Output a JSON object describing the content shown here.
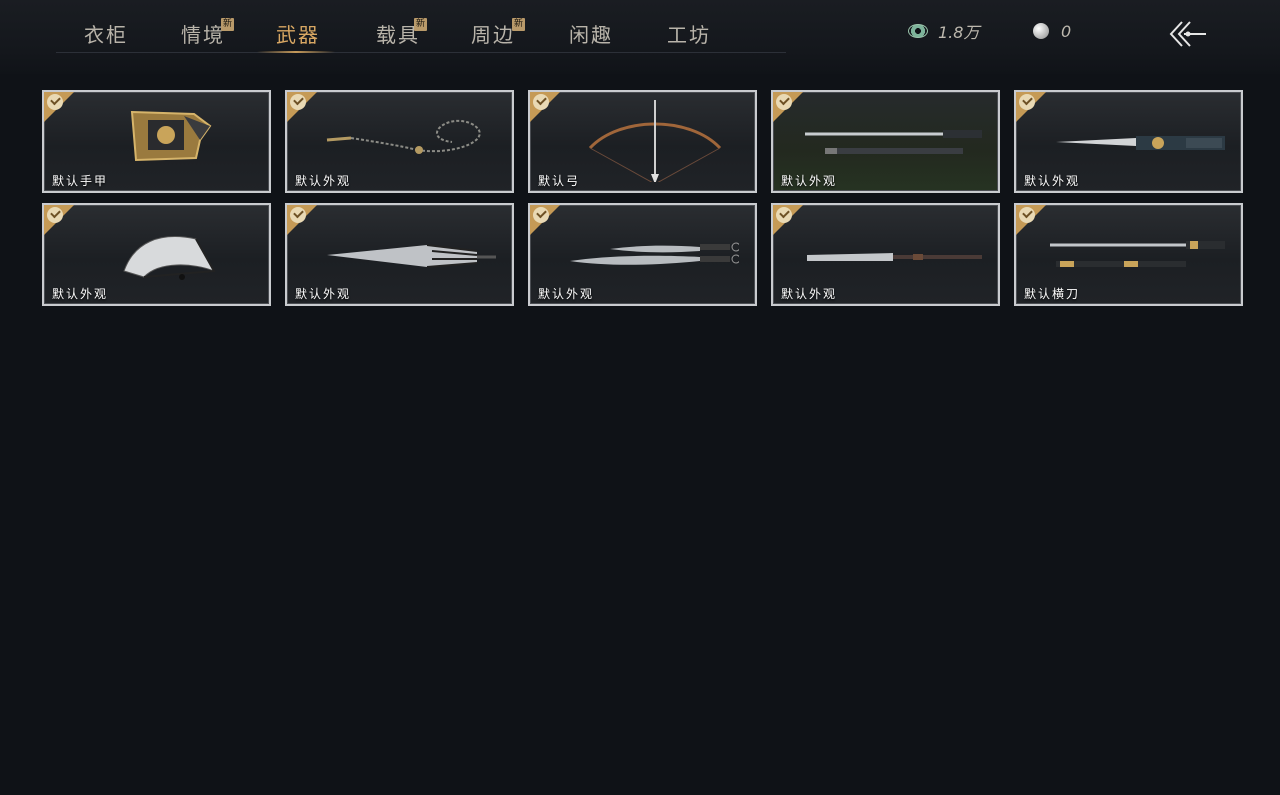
{
  "tabs": [
    {
      "label": "衣柜",
      "new": false
    },
    {
      "label": "情境",
      "new": true
    },
    {
      "label": "武器",
      "new": false,
      "active": true
    },
    {
      "label": "载具",
      "new": true
    },
    {
      "label": "周边",
      "new": true
    },
    {
      "label": "闲趣",
      "new": false
    },
    {
      "label": "工坊",
      "new": false
    }
  ],
  "new_badge_text": "新",
  "currencies": [
    {
      "icon": "jade-coin-icon",
      "value": "1.8万"
    },
    {
      "icon": "pearl-icon",
      "value": "0"
    }
  ],
  "items": [
    {
      "label": "默认手甲",
      "art": "gauntlet-icon",
      "equipped": true
    },
    {
      "label": "默认外观",
      "art": "rope-dart-icon",
      "equipped": true
    },
    {
      "label": "默认弓",
      "art": "bow-icon",
      "equipped": true
    },
    {
      "label": "默认外观",
      "art": "sword-and-scabbard-icon",
      "equipped": true
    },
    {
      "label": "默认外观",
      "art": "ornate-sword-icon",
      "equipped": true
    },
    {
      "label": "默认外观",
      "art": "folding-fan-icon",
      "equipped": true
    },
    {
      "label": "默认外观",
      "art": "umbrella-icon",
      "equipped": true
    },
    {
      "label": "默认外观",
      "art": "twin-sabres-icon",
      "equipped": true
    },
    {
      "label": "默认外观",
      "art": "glaive-icon",
      "equipped": true
    },
    {
      "label": "默认横刀",
      "art": "hengdao-icon",
      "equipped": true
    }
  ],
  "colors": {
    "accent": "#d8a763",
    "check": "#c59a56",
    "background": "#0f1217"
  }
}
